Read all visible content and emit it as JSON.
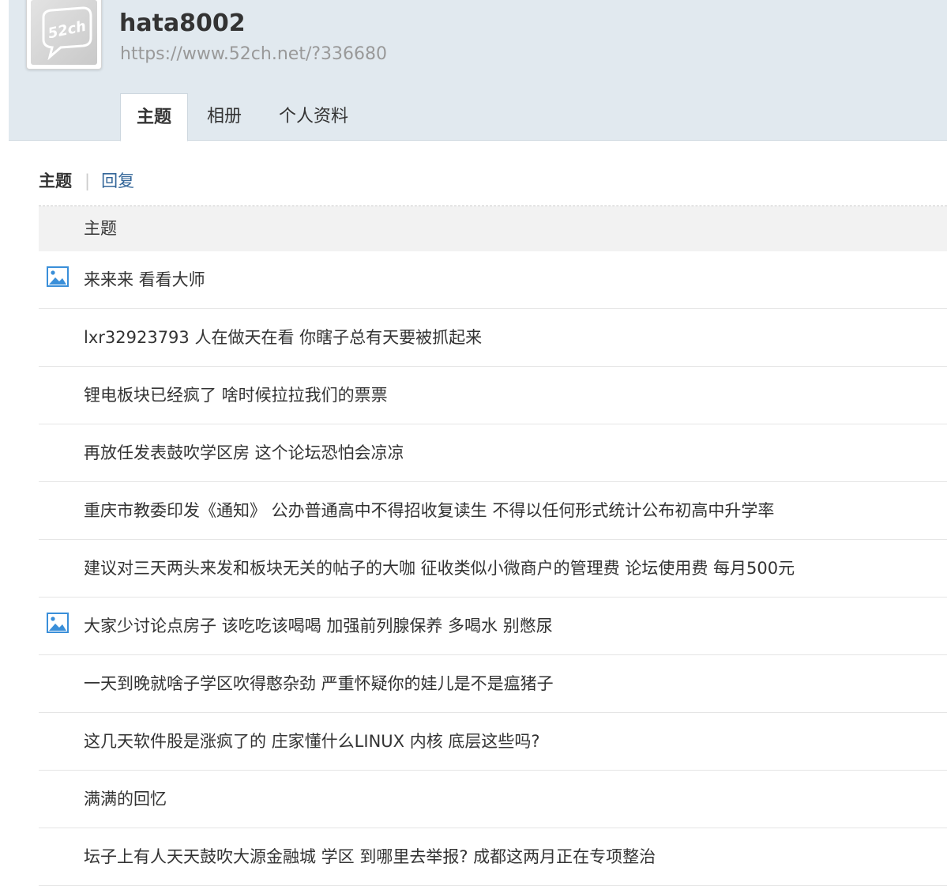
{
  "profile": {
    "username": "hata8002",
    "url": "https://www.52ch.net/?336680",
    "avatar_icon": "52ch-logo-avatar",
    "avatar_logo_text": "52ch"
  },
  "tabs": [
    {
      "label": "主题",
      "active": true
    },
    {
      "label": "相册",
      "active": false
    },
    {
      "label": "个人资料",
      "active": false
    }
  ],
  "subtabs": {
    "active": "主题",
    "other": "回复"
  },
  "table": {
    "header": "主题",
    "rows": [
      {
        "title": "来来来 看看大师",
        "has_image_icon": true
      },
      {
        "title": "lxr32923793 人在做天在看 你瞎子总有天要被抓起来",
        "has_image_icon": false
      },
      {
        "title": "锂电板块已经疯了 啥时候拉拉我们的票票",
        "has_image_icon": false
      },
      {
        "title": "再放任发表鼓吹学区房 这个论坛恐怕会凉凉",
        "has_image_icon": false
      },
      {
        "title": "重庆市教委印发《通知》 公办普通高中不得招收复读生 不得以任何形式统计公布初高中升学率",
        "has_image_icon": false
      },
      {
        "title": "建议对三天两头来发和板块无关的帖子的大咖 征收类似小微商户的管理费 论坛使用费 每月500元",
        "has_image_icon": false
      },
      {
        "title": "大家少讨论点房子 该吃吃该喝喝 加强前列腺保养 多喝水 别憋尿",
        "has_image_icon": true
      },
      {
        "title": "一天到晚就啥子学区吹得憨杂劲 严重怀疑你的娃儿是不是瘟猪子",
        "has_image_icon": false
      },
      {
        "title": "这几天软件股是涨疯了的 庄家懂什么LINUX 内核 底层这些吗?",
        "has_image_icon": false
      },
      {
        "title": "满满的回忆",
        "has_image_icon": false
      },
      {
        "title": "坛子上有人天天鼓吹大源金融城 学区 到哪里去举报? 成都这两月正在专项整治",
        "has_image_icon": false
      }
    ]
  },
  "colors": {
    "header_bg": "#e1e9ef",
    "link": "#336699",
    "table_head_bg": "#f2f2f2",
    "image_icon": "#3a8fd9"
  }
}
